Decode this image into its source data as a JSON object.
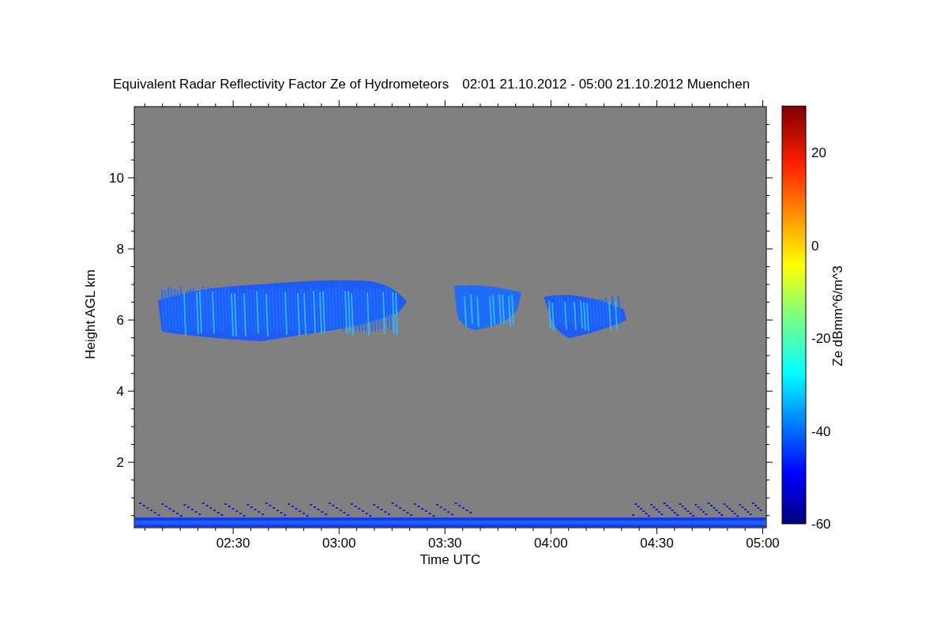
{
  "title": "Equivalent Radar Reflectivity Factor Ze of Hydrometeors",
  "period": "02:01 21.10.2012 - 05:00 21.10.2012 Muenchen",
  "x_axis": {
    "label": "Time UTC",
    "ticks": [
      "02:30",
      "03:00",
      "03:30",
      "04:00",
      "04:30",
      "05:00"
    ]
  },
  "y_axis": {
    "label": "Height AGL km",
    "ticks": [
      "10",
      "8",
      "6",
      "4",
      "2"
    ]
  },
  "colorbar": {
    "label": "Ze dBmm^6/m^3",
    "ticks": [
      "20",
      "0",
      "-20",
      "-40",
      "-60"
    ]
  }
}
